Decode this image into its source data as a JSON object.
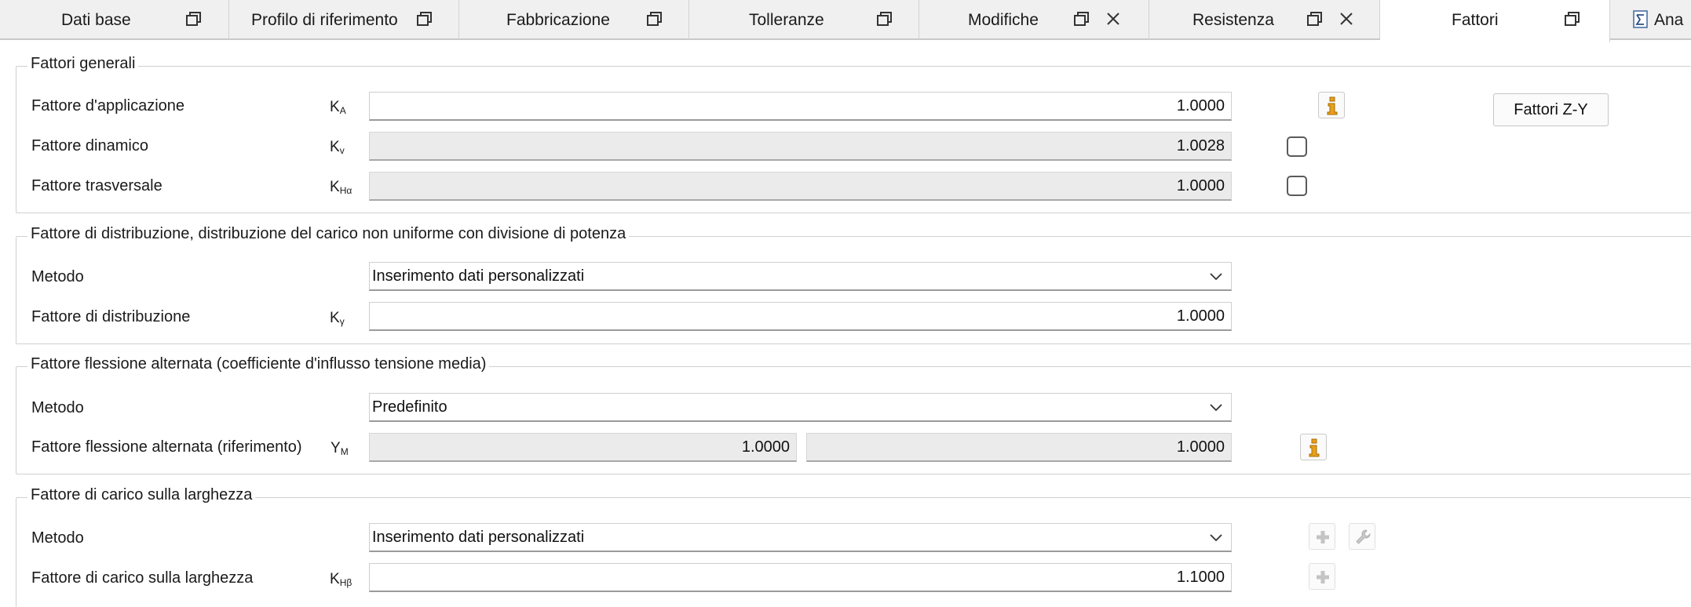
{
  "tabs": [
    {
      "label": "Dati base",
      "restore_icon": "restore-window-icon"
    },
    {
      "label": "Profilo di riferimento",
      "restore_icon": "restore-window-icon"
    },
    {
      "label": "Fabbricazione",
      "restore_icon": "restore-window-icon"
    },
    {
      "label": "Tolleranze",
      "restore_icon": "restore-window-icon"
    },
    {
      "label": "Modifiche",
      "restore_icon": "restore-window-icon",
      "close_icon": "close-icon"
    },
    {
      "label": "Resistenza",
      "restore_icon": "restore-window-icon",
      "close_icon": "close-icon"
    },
    {
      "label": "Fattori",
      "restore_icon": "restore-window-icon",
      "active": true
    },
    {
      "label": "Ana",
      "leading_icon": "report-sigma-icon"
    }
  ],
  "general_factors": {
    "title": "Fattori generali",
    "application": {
      "label": "Fattore d'applicazione",
      "symbol": "K",
      "sub": "A",
      "value": "1.0000",
      "info_icon": "info-icon"
    },
    "dynamic": {
      "label": "Fattore dinamico",
      "symbol": "K",
      "sub": "v",
      "value": "1.0028",
      "checked": false
    },
    "transverse": {
      "label": "Fattore trasversale",
      "symbol": "K",
      "sub": "Hα",
      "value": "1.0000",
      "checked": false
    },
    "zy_button": "Fattori Z-Y"
  },
  "distribution": {
    "title": "Fattore di distribuzione, distribuzione del carico non uniforme con divisione di potenza",
    "method_label": "Metodo",
    "method_value": "Inserimento dati personalizzati",
    "factor": {
      "label": "Fattore di distribuzione",
      "symbol": "K",
      "sub": "γ",
      "value": "1.0000"
    }
  },
  "alternating_bending": {
    "title": "Fattore flessione alternata (coefficiente d'influsso tensione media)",
    "method_label": "Metodo",
    "method_value": "Predefinito",
    "factor": {
      "label": "Fattore flessione alternata (riferimento)",
      "symbol": "Y",
      "sub": "M",
      "value1": "1.0000",
      "value2": "1.0000",
      "info_icon": "info-icon"
    }
  },
  "face_load": {
    "title": "Fattore di carico sulla larghezza",
    "method_label": "Metodo",
    "method_value": "Inserimento dati personalizzati",
    "factor": {
      "label": "Fattore di carico sulla larghezza",
      "symbol": "K",
      "sub": "Hβ",
      "value": "1.1000"
    },
    "icons": [
      "plus-icon",
      "wrench-icon",
      "plus-icon"
    ]
  },
  "colors": {
    "accent_info": "#e8a01a",
    "readonly_bg": "#ebebeb",
    "tab_bg": "#f0f0f0"
  }
}
